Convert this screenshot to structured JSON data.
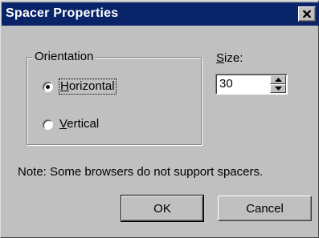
{
  "window": {
    "title": "Spacer Properties",
    "close_icon": "close-icon"
  },
  "orientation": {
    "label": "Orientation",
    "options": [
      {
        "label_prefix": "",
        "mnemonic": "H",
        "label_rest": "orizontal",
        "selected": true
      },
      {
        "label_prefix": "",
        "mnemonic": "V",
        "label_rest": "ertical",
        "selected": false
      }
    ]
  },
  "size": {
    "label_mnemonic": "S",
    "label_rest": "ize:",
    "value": "30"
  },
  "note": "Note: Some browsers do not support spacers.",
  "buttons": {
    "ok": "OK",
    "cancel": "Cancel"
  }
}
